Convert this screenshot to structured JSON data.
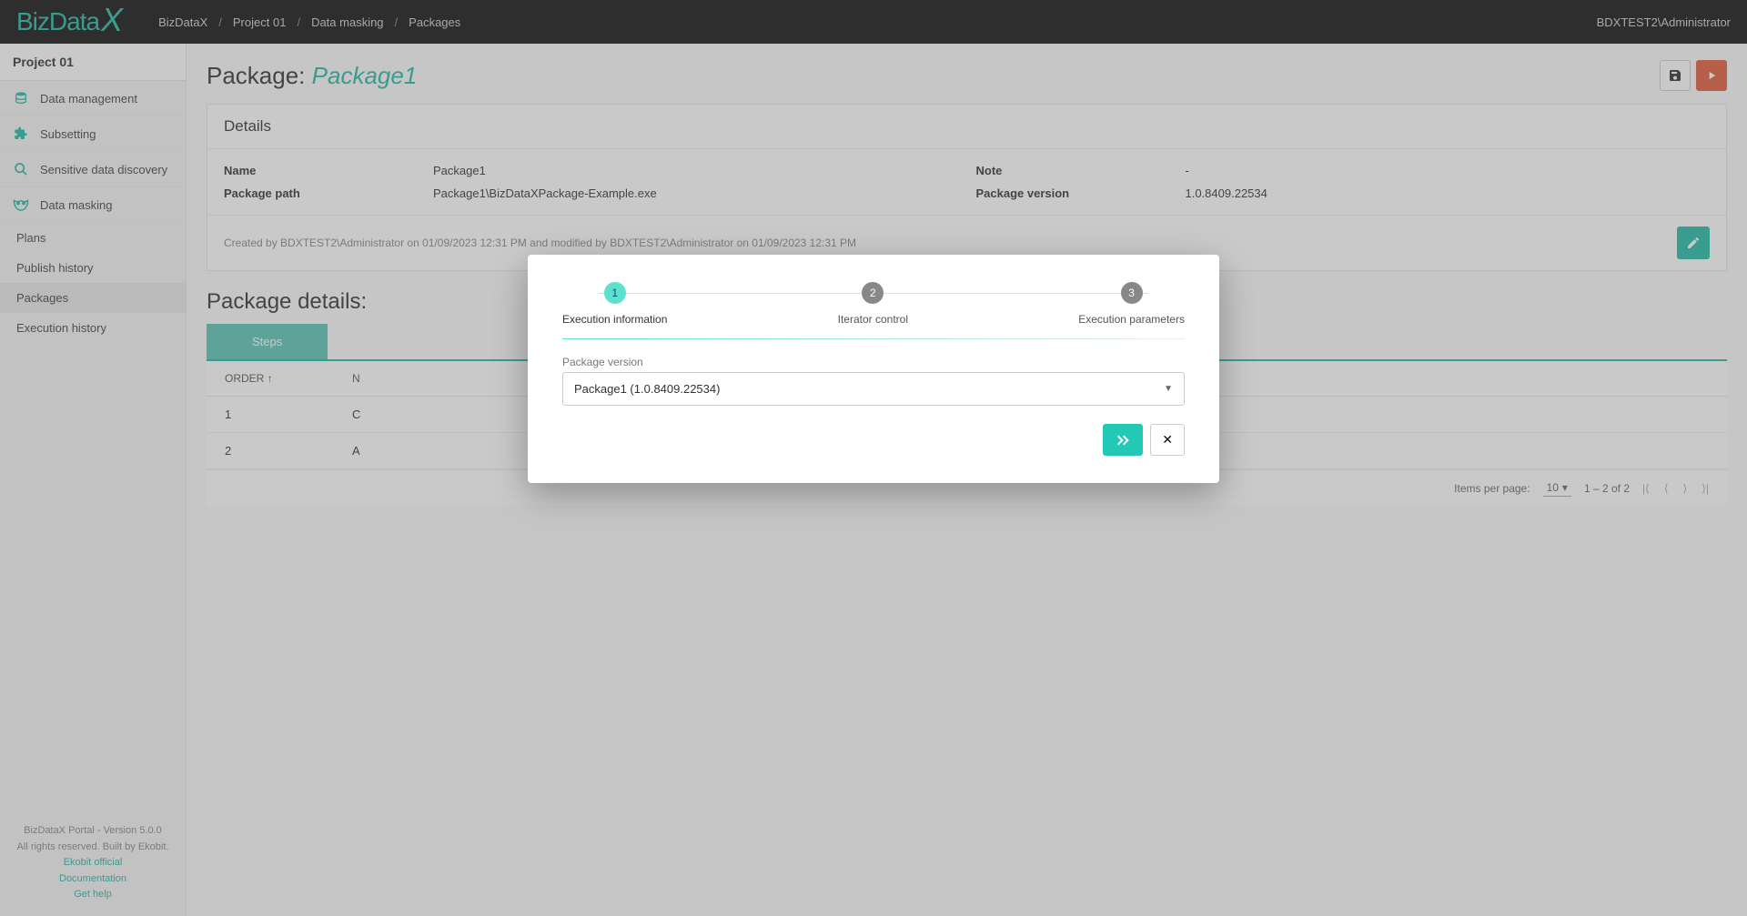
{
  "app": {
    "logo_a": "BizData",
    "logo_b": "X"
  },
  "breadcrumb": [
    "BizDataX",
    "Project 01",
    "Data masking",
    "Packages"
  ],
  "user": "BDXTEST2\\Administrator",
  "sidebar": {
    "project": "Project 01",
    "items": [
      {
        "label": "Data management"
      },
      {
        "label": "Subsetting"
      },
      {
        "label": "Sensitive data discovery"
      },
      {
        "label": "Data masking"
      }
    ],
    "subitems": [
      {
        "label": "Plans"
      },
      {
        "label": "Publish history"
      },
      {
        "label": "Packages",
        "active": true
      },
      {
        "label": "Execution history"
      }
    ],
    "footer": {
      "line1": "BizDataX Portal - Version 5.0.0",
      "line2": "All rights reserved. Built by Ekobit.",
      "link1": "Ekobit official",
      "link2": "Documentation",
      "link3": "Get help"
    }
  },
  "page": {
    "title_prefix": "Package: ",
    "title_name": "Package1",
    "details_heading": "Details",
    "details": {
      "name_label": "Name",
      "name_value": "Package1",
      "path_label": "Package path",
      "path_value": "Package1\\BizDataXPackage-Example.exe",
      "note_label": "Note",
      "note_value": "-",
      "version_label": "Package version",
      "version_value": "1.0.8409.22534"
    },
    "audit": "Created by BDXTEST2\\Administrator on 01/09/2023 12:31 PM and modified by BDXTEST2\\Administrator on 01/09/2023 12:31 PM",
    "section2": "Package details:",
    "tabs": [
      "Steps"
    ],
    "table": {
      "header_order": "ORDER ↑",
      "header_name": "N",
      "rows": [
        {
          "order": "1",
          "name": "C"
        },
        {
          "order": "2",
          "name": "A"
        }
      ]
    },
    "paginator": {
      "items_per_page_label": "Items per page:",
      "items_per_page_value": "10",
      "range": "1 – 2 of 2"
    }
  },
  "modal": {
    "steps": [
      {
        "num": "1",
        "label": "Execution information"
      },
      {
        "num": "2",
        "label": "Iterator control"
      },
      {
        "num": "3",
        "label": "Execution parameters"
      }
    ],
    "field_label": "Package version",
    "select_value": "Package1 (1.0.8409.22534)"
  }
}
